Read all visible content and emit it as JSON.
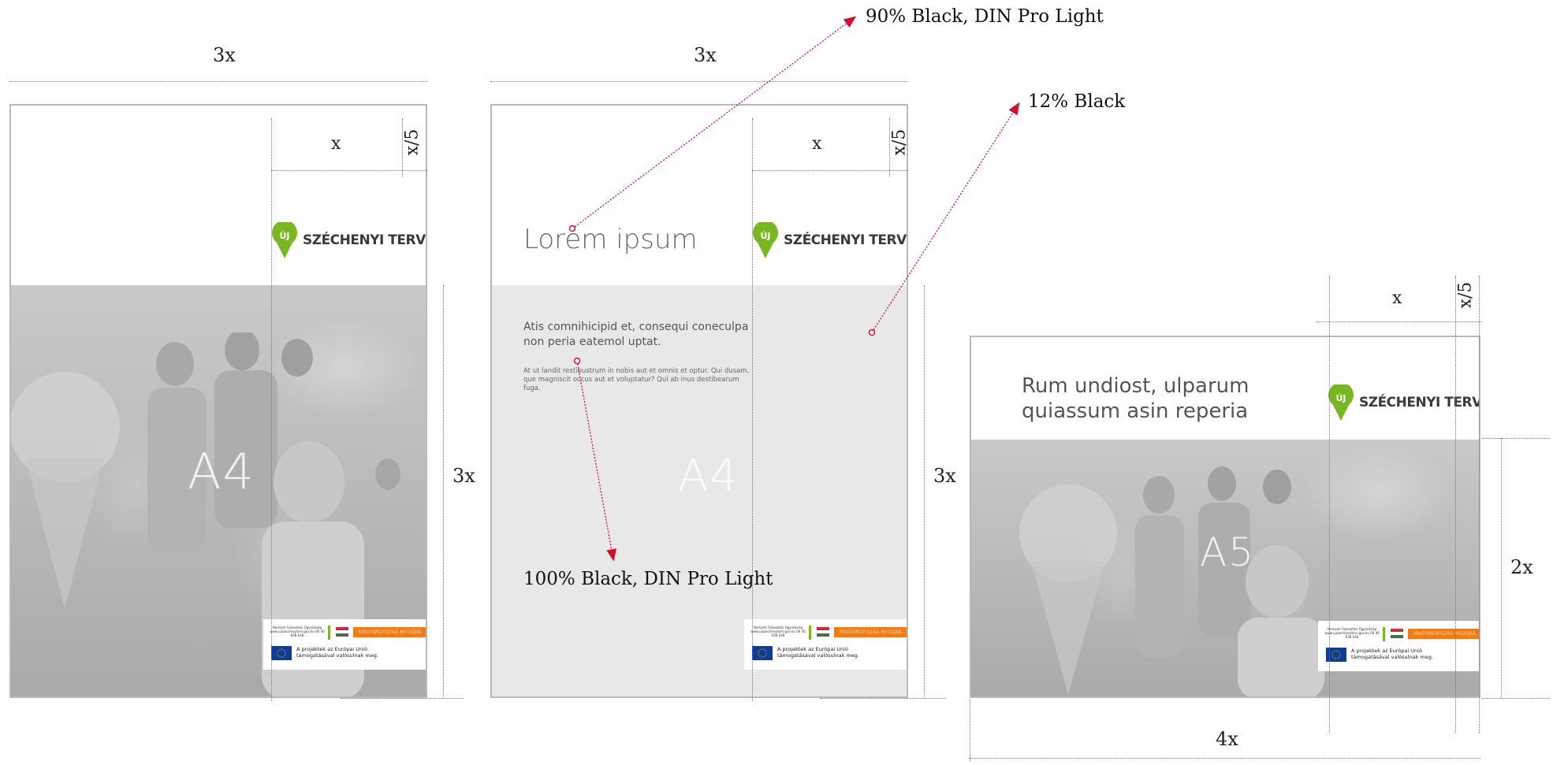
{
  "dimensions": {
    "width_3x": "3x",
    "height_3x": "3x",
    "logo_zone_x": "x",
    "logo_margin_x5": "x/5",
    "height_2x": "2x",
    "width_4x": "4x"
  },
  "annotations": {
    "headline_spec": "90% Black, DIN Pro Light",
    "panel_spec": "12% Black",
    "body_spec": "100% Black, DIN Pro Light"
  },
  "colors": {
    "annotation_arrow": "#d1102a",
    "panel_fill": "#e8e8e8",
    "logo_green": "#7ab623",
    "footer_orange": "#ee7c1a",
    "eu_blue": "#103c91",
    "page_border": "#b9b9b9"
  },
  "logo": {
    "badge_text": "ÚJ",
    "wordmark": "SZÉCHENYI TERV"
  },
  "footer": {
    "org_line": "Nemzeti Fejlesztési Ügynökség www.ujszechenyiterv.gov.hu 06 40 638 638",
    "orange_bar_text": "MAGYARORSZÁG MEGÚJUL",
    "eu_text": "A projektek az Európai Unió támogatásával valósulnak meg."
  },
  "layouts": [
    {
      "format_label": "A4",
      "variant": "photo"
    },
    {
      "format_label": "A4",
      "variant": "text",
      "headline": "Lorem ipsum",
      "lead": "Atis comnihicipid et, consequi coneculpa non peria eatemol uptat.",
      "body": "At ut landit restibustrum in nobis aut et omnis et optur. Qui dusam, que magniscit occus aut et voluptatur? Qui ab inus destibearum fuga."
    },
    {
      "format_label": "A5",
      "variant": "landscape",
      "headline_line1": "Rum undiost, ulparum",
      "headline_line2": "quiassum asin reperia"
    }
  ],
  "icons": [
    "uj-szechenyi-logo-icon",
    "hungarian-flag-icon",
    "eu-flag-icon",
    "arrow-icon"
  ]
}
